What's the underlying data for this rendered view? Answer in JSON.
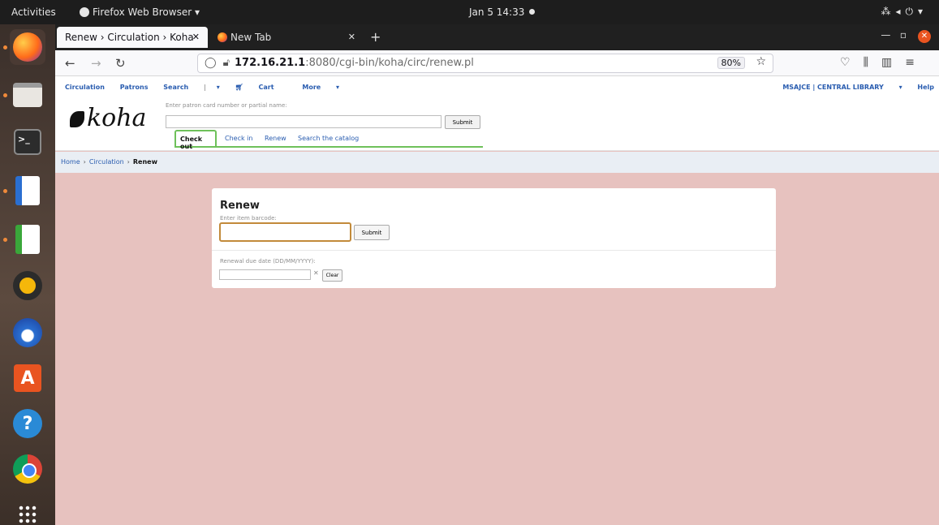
{
  "system": {
    "activities": "Activities",
    "app_menu": "Firefox Web Browser ▾",
    "clock": "Jan 5  14:33",
    "tray_icons": [
      "network-icon",
      "volume-icon",
      "power-icon"
    ]
  },
  "dock": {
    "items": [
      "firefox-icon",
      "files-icon",
      "terminal-icon",
      "libreoffice-writer-icon",
      "libreoffice-calc-icon",
      "rhythmbox-icon",
      "thunderbird-icon",
      "software-center-icon",
      "help-icon",
      "chrome-icon",
      "show-apps-icon"
    ]
  },
  "browser": {
    "tabs": [
      {
        "label": "Renew › Circulation › Koha",
        "active": true
      },
      {
        "label": "New Tab",
        "active": false
      }
    ],
    "url_host": "172.16.21.1",
    "url_path": ":8080/cgi-bin/koha/circ/renew.pl",
    "zoom": "80%"
  },
  "koha": {
    "topnav": [
      "Circulation",
      "Patrons",
      "Search"
    ],
    "cart": "Cart",
    "more": "More",
    "library": "MSAJCE | CENTRAL LIBRARY",
    "help": "Help",
    "logo": "koha",
    "patron_label": "Enter patron card number or partial name:",
    "patron_submit": "Submit",
    "mode_tabs": [
      "Check out",
      "Check in",
      "Renew",
      "Search the catalog"
    ],
    "breadcrumb": [
      "Home",
      "Circulation",
      "Renew"
    ],
    "renew": {
      "title": "Renew",
      "barcode_label": "Enter item barcode:",
      "barcode_submit": "Submit",
      "due_label": "Renewal due date (DD/MM/YYYY):",
      "clear_button": "Clear"
    }
  },
  "colors": {
    "page_background": "#e7c2bf",
    "link": "#2a5db0",
    "tab_accent": "#6ec15a",
    "focus_border": "#c28a3a"
  }
}
